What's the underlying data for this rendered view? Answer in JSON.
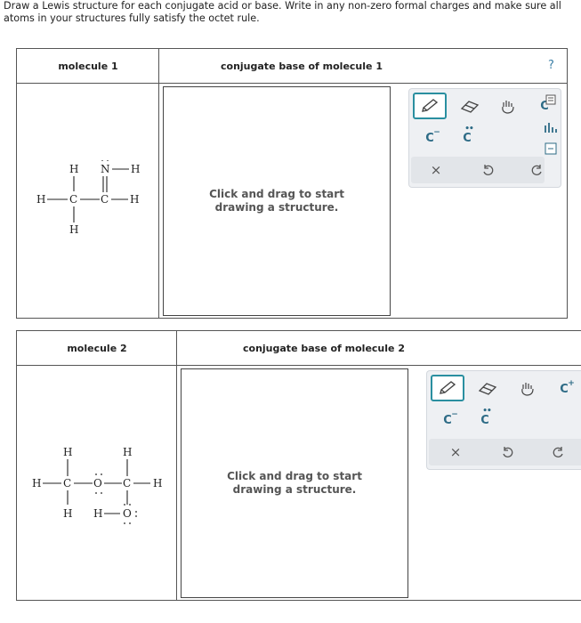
{
  "instructions": "Draw a Lewis structure for each conjugate acid or base. Write in any non-zero formal charges and make sure all atoms in your structures fully satisfy the octet rule.",
  "problems": [
    {
      "molecule_header": "molecule 1",
      "target_header": "conjugate base of molecule 1",
      "canvas_hint": "Click and drag to start drawing a structure.",
      "help_label": "?",
      "atoms": [
        "H",
        "H",
        "C",
        "C",
        "N",
        "H",
        "H",
        "H"
      ],
      "bond_symbols": {
        "n": "N",
        "h": "H",
        "c": "C"
      }
    },
    {
      "molecule_header": "molecule 2",
      "target_header": "conjugate base of molecule 2",
      "canvas_hint": "Click and drag to start drawing a structure.",
      "atoms": {
        "c": "C",
        "o": "O",
        "h": "H"
      }
    }
  ],
  "toolbar": {
    "tools": [
      "pencil",
      "eraser",
      "hand"
    ],
    "atom_buttons": [
      "C",
      "C",
      "C"
    ],
    "charge_plus": "+",
    "charge_minus": "−",
    "actions": [
      "×",
      "undo",
      "redo"
    ]
  },
  "colors": {
    "accent": "#2a8fa0",
    "atom_blue": "#2d6b86",
    "border": "#555555"
  }
}
